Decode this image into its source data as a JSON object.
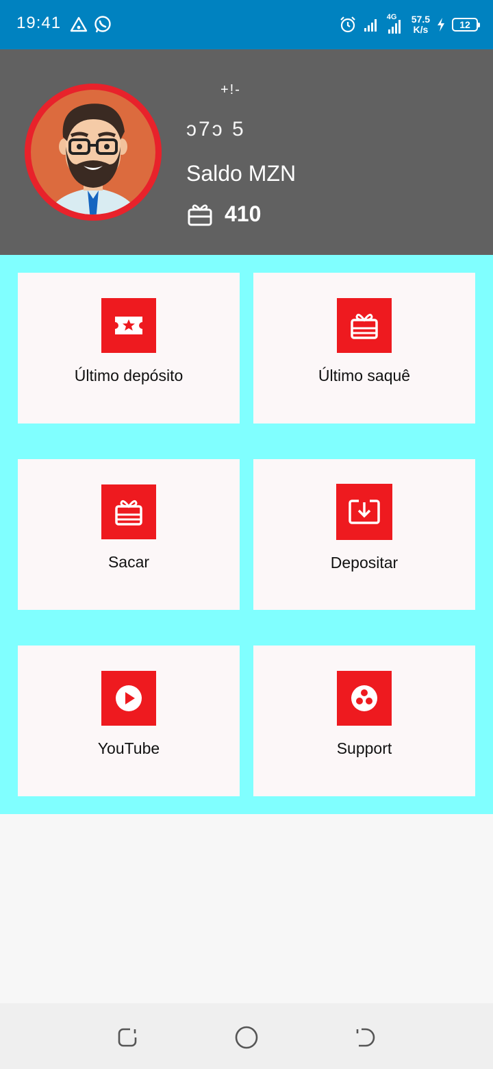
{
  "status_bar": {
    "time": "19:41",
    "network_type": "4G",
    "net_speed_value": "57.5",
    "net_speed_unit": "K/s",
    "battery_level": "12"
  },
  "profile": {
    "user_id_partial_top": "+!-",
    "user_id_partial": "ɔ7ɔ      5",
    "balance_label": "Saldo MZN",
    "balance_value": "410"
  },
  "menu": {
    "items": [
      {
        "label": "Último depósito",
        "icon": "ticket-star-icon"
      },
      {
        "label": "Último saquê",
        "icon": "gift-icon"
      },
      {
        "label": "Sacar",
        "icon": "gift-icon"
      },
      {
        "label": "Depositar",
        "icon": "download-tray-icon"
      },
      {
        "label": "YouTube",
        "icon": "play-circle-icon"
      },
      {
        "label": "Support",
        "icon": "support-dots-icon"
      }
    ]
  },
  "colors": {
    "status_bar": "#0082c0",
    "header": "#616161",
    "menu_background": "#80ffff",
    "accent": "#ee1a1f"
  }
}
